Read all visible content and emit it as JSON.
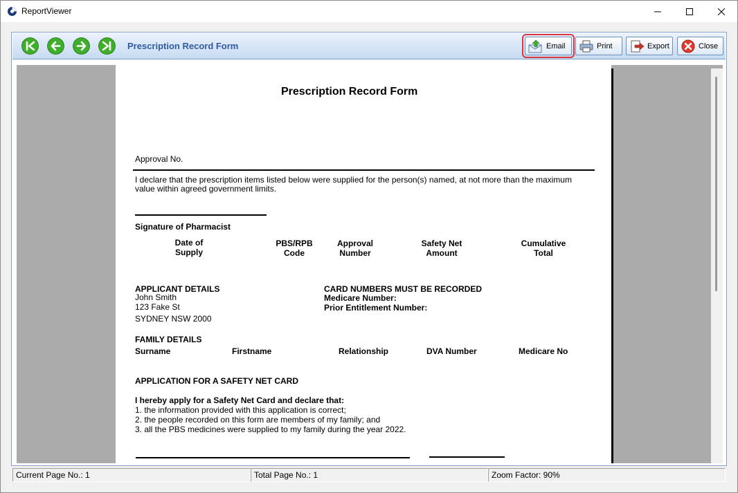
{
  "window": {
    "title": "ReportViewer"
  },
  "toolbar": {
    "report_title": "Prescription Record Form",
    "email_label": "Email",
    "print_label": "Print",
    "export_label": "Export",
    "close_label": "Close"
  },
  "report": {
    "title": "Prescription Record Form",
    "approval_label": "Approval No.",
    "declaration_line1": "I declare that the prescription items listed below were supplied for the person(s)  named, at not more than the maximum",
    "declaration_line2": "value within agreed government limits.",
    "signature_label": "Signature of Pharmacist",
    "columns": [
      {
        "line1": "Date of",
        "line2": "Supply"
      },
      {
        "line1": "PBS/RPB",
        "line2": "Code"
      },
      {
        "line1": "Approval",
        "line2": "Number"
      },
      {
        "line1": "Safety Net",
        "line2": "Amount"
      },
      {
        "line1": "Cumulative",
        "line2": "Total"
      }
    ],
    "applicant_heading": "APPLICANT DETAILS",
    "applicant_name": "John  Smith",
    "applicant_street": "123 Fake St",
    "applicant_city": "SYDNEY  NSW  2000",
    "card_heading": "CARD NUMBERS MUST BE RECORDED",
    "medicare_label": "Medicare Number:",
    "prior_label": "Prior Entitlement Number:",
    "family_heading": "FAMILY DETAILS",
    "family_columns": [
      "Surname",
      "Firstname",
      "Relationship",
      "DVA Number",
      "Medicare No"
    ],
    "safety_heading": "APPLICATION FOR A  SAFETY NET CARD",
    "apply_heading": "I hereby apply for a  Safety Net Card and declare that:",
    "apply_items": [
      "1. the information provided with this application is correct;",
      "2. the people recorded on this form are members of my family; and",
      "3.  all the PBS medicines were supplied to my family during the year 2022."
    ]
  },
  "status": {
    "current_page": "Current Page No.: 1",
    "total_page": "Total Page No.: 1",
    "zoom": "Zoom Factor: 90%"
  },
  "colors": {
    "accent": "#2f5aa0",
    "nav_green": "#3fae2a",
    "highlight": "#d9363e"
  }
}
